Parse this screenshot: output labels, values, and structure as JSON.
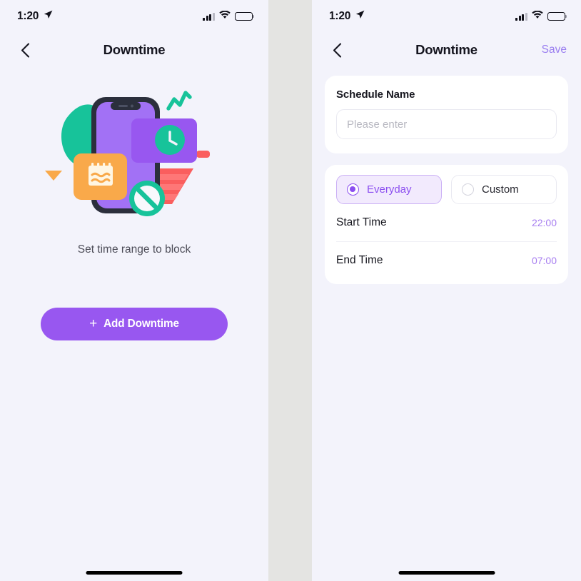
{
  "status_bar": {
    "time": "1:20",
    "location_icon": "location-arrow-icon",
    "cellular_icon": "cellular-signal-icon",
    "wifi_icon": "wifi-icon",
    "battery_icon": "battery-full-icon"
  },
  "left_screen": {
    "nav": {
      "back_icon": "chevron-left-icon",
      "title": "Downtime"
    },
    "illustration_name": "downtime-empty-state-illustration",
    "empty_caption": "Set time range to block",
    "add_button": {
      "plus": "+",
      "label": "Add Downtime"
    }
  },
  "right_screen": {
    "nav": {
      "back_icon": "chevron-left-icon",
      "title": "Downtime",
      "save_label": "Save"
    },
    "schedule_name": {
      "label": "Schedule Name",
      "value": "",
      "placeholder": "Please enter"
    },
    "repeat_modes": [
      {
        "label": "Everyday",
        "selected": true
      },
      {
        "label": "Custom",
        "selected": false
      }
    ],
    "times": [
      {
        "label": "Start Time",
        "value": "22:00"
      },
      {
        "label": "End Time",
        "value": "07:00"
      }
    ]
  },
  "colors": {
    "screen_background": "#f3f3fb",
    "gutter": "#e4e4e2",
    "accent_purple": "#9857f0",
    "accent_purple_light": "#a77ef0",
    "segment_active_bg": "#f2eafd",
    "card_white": "#ffffff",
    "text_primary": "#17171f",
    "text_muted": "#4d4d58",
    "placeholder": "#b7b7c0",
    "illo_teal": "#17c39a",
    "illo_purple": "#9857f0",
    "illo_orange": "#f9a94a",
    "illo_red": "#fa5e5e",
    "illo_dark": "#2b2f3c"
  }
}
